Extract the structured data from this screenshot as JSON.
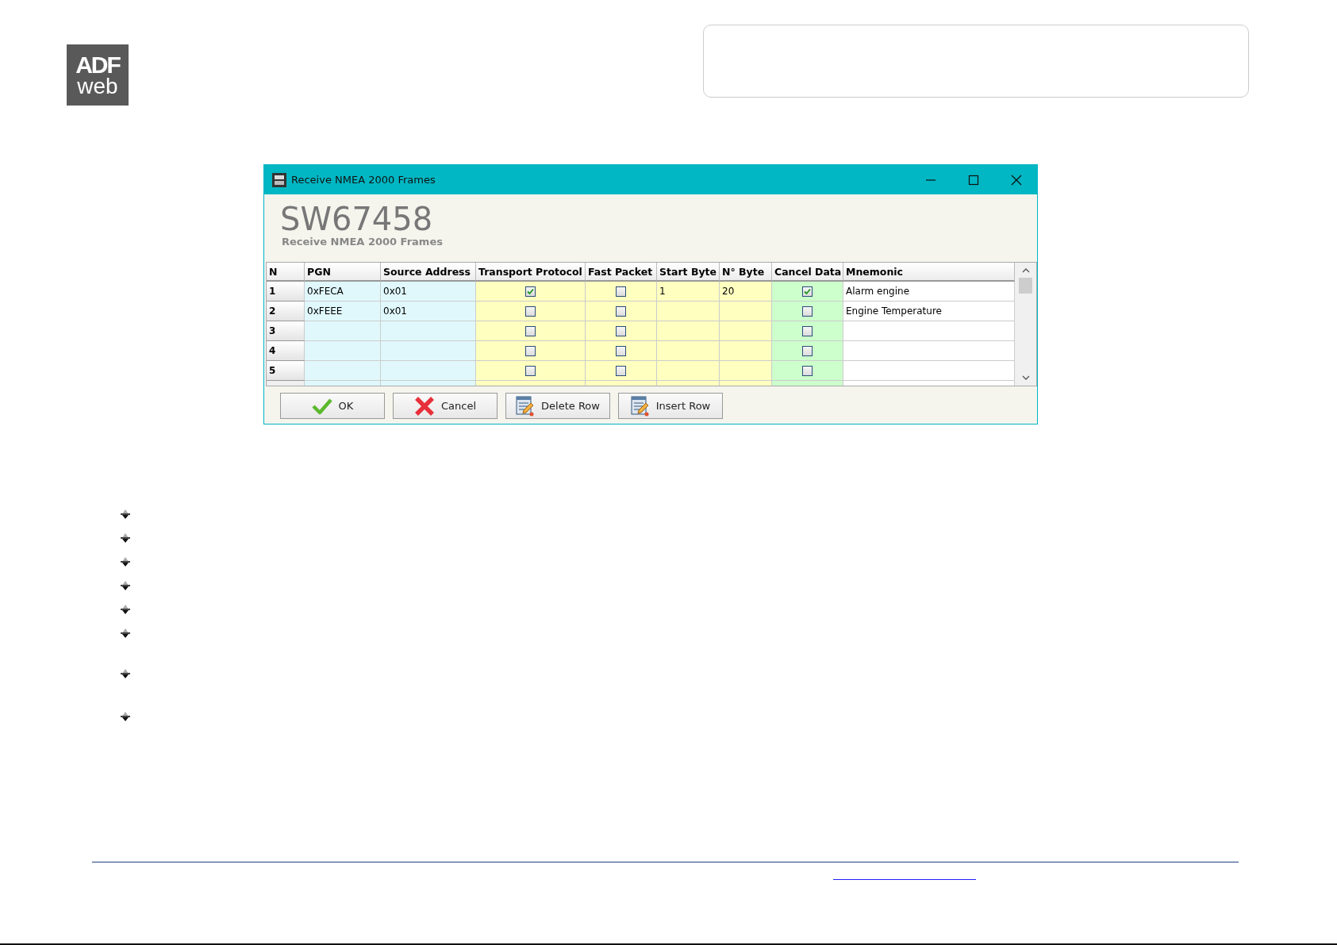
{
  "logo": {
    "line1": "ADF",
    "line2": "web"
  },
  "dialog": {
    "title": "Receive NMEA 2000 Frames",
    "heading": "SW67458",
    "subheading": "Receive NMEA 2000 Frames",
    "columns": [
      "N",
      "PGN",
      "Source Address",
      "Transport Protocol",
      "Fast Packet",
      "Start Byte",
      "N° Byte",
      "Cancel Data",
      "Mnemonic"
    ],
    "rows": [
      {
        "n": "1",
        "pgn": "0xFECA",
        "source_address": "0x01",
        "transport_protocol": true,
        "fast_packet": false,
        "start_byte": "1",
        "n_byte": "20",
        "cancel_data": true,
        "mnemonic": "Alarm engine"
      },
      {
        "n": "2",
        "pgn": "0xFEEE",
        "source_address": "0x01",
        "transport_protocol": false,
        "fast_packet": false,
        "cancel_data": false,
        "mnemonic": "Engine Temperature"
      },
      {
        "n": "3",
        "transport_protocol": false,
        "fast_packet": false,
        "cancel_data": false
      },
      {
        "n": "4",
        "transport_protocol": false,
        "fast_packet": false,
        "cancel_data": false
      },
      {
        "n": "5",
        "transport_protocol": false,
        "fast_packet": false,
        "cancel_data": false
      }
    ],
    "buttons": [
      {
        "label": "OK",
        "kind": "ok"
      },
      {
        "label": "Cancel",
        "kind": "cancel"
      },
      {
        "label": "Delete Row",
        "kind": "delete"
      },
      {
        "label": "Insert Row",
        "kind": "insert"
      }
    ]
  }
}
